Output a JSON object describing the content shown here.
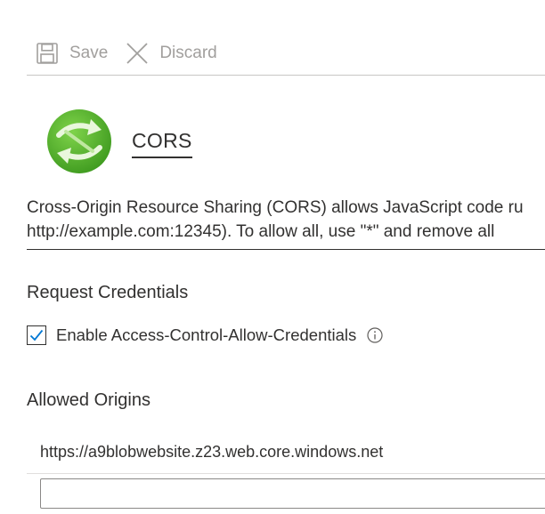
{
  "toolbar": {
    "save_label": "Save",
    "discard_label": "Discard",
    "save_icon": "save-icon",
    "discard_icon": "close-icon"
  },
  "header": {
    "title": "CORS",
    "logo_icon": "cors-logo-icon"
  },
  "description": {
    "line1": "Cross-Origin Resource Sharing (CORS) allows JavaScript code ru",
    "line2": "http://example.com:12345). To allow all, use \"*\" and remove all"
  },
  "credentials": {
    "section_label": "Request Credentials",
    "checkbox_label": "Enable Access-Control-Allow-Credentials",
    "checked": true
  },
  "origins": {
    "section_label": "Allowed Origins",
    "items": [
      "https://a9blobwebsite.z23.web.core.windows.net"
    ],
    "new_value": ""
  },
  "colors": {
    "accent": "#0078d4",
    "text": "#323130",
    "disabled": "#a19f9d",
    "logo_green": "#5cb82e"
  }
}
